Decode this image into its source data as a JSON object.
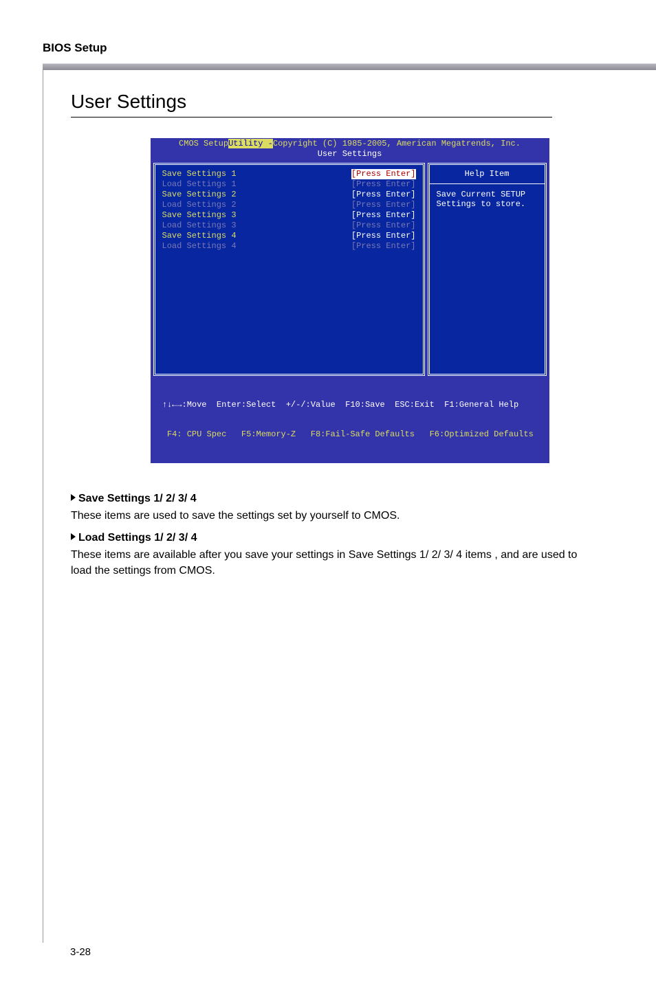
{
  "doc": {
    "header": "BIOS Setup",
    "section_title": "User Settings",
    "page_number": "3-28"
  },
  "bios": {
    "title_left": "CMOS Setup ",
    "title_inv": "Utility -",
    "title_right": " Copyright (C) 1985-2005, American Megatrends, Inc.",
    "subtitle": "User Settings",
    "menu": [
      {
        "label": "Save Settings 1",
        "value": "[Press Enter]",
        "type": "save",
        "selected_val": true
      },
      {
        "label": "Load Settings 1",
        "value": "[Press Enter]",
        "type": "load"
      },
      {
        "label": "Save Settings 2",
        "value": "[Press Enter]",
        "type": "save"
      },
      {
        "label": "Load Settings 2",
        "value": "[Press Enter]",
        "type": "load"
      },
      {
        "label": "Save Settings 3",
        "value": "[Press Enter]",
        "type": "save"
      },
      {
        "label": "Load Settings 3",
        "value": "[Press Enter]",
        "type": "load"
      },
      {
        "label": "Save Settings 4",
        "value": "[Press Enter]",
        "type": "save"
      },
      {
        "label": "Load Settings 4",
        "value": "[Press Enter]",
        "type": "load"
      }
    ],
    "help_title": "Help Item",
    "help_body_1": "Save Current SETUP",
    "help_body_2": "Settings to store.",
    "footer1": " ↑↓←→:Move  Enter:Select  +/-/:Value  F10:Save  ESC:Exit  F1:General Help",
    "footer2": "  F4: CPU Spec   F5:Memory-Z   F8:Fail-Safe Defaults   F6:Optimized Defaults"
  },
  "text": {
    "h1": "Save Settings 1/ 2/ 3/ 4",
    "p1": "These items are used to save the settings set by yourself to CMOS.",
    "h2": "Load Settings 1/ 2/ 3/ 4",
    "p2": "These items are available after you save your settings in Save Settings 1/ 2/ 3/ 4 items , and are used to load the settings from CMOS."
  }
}
